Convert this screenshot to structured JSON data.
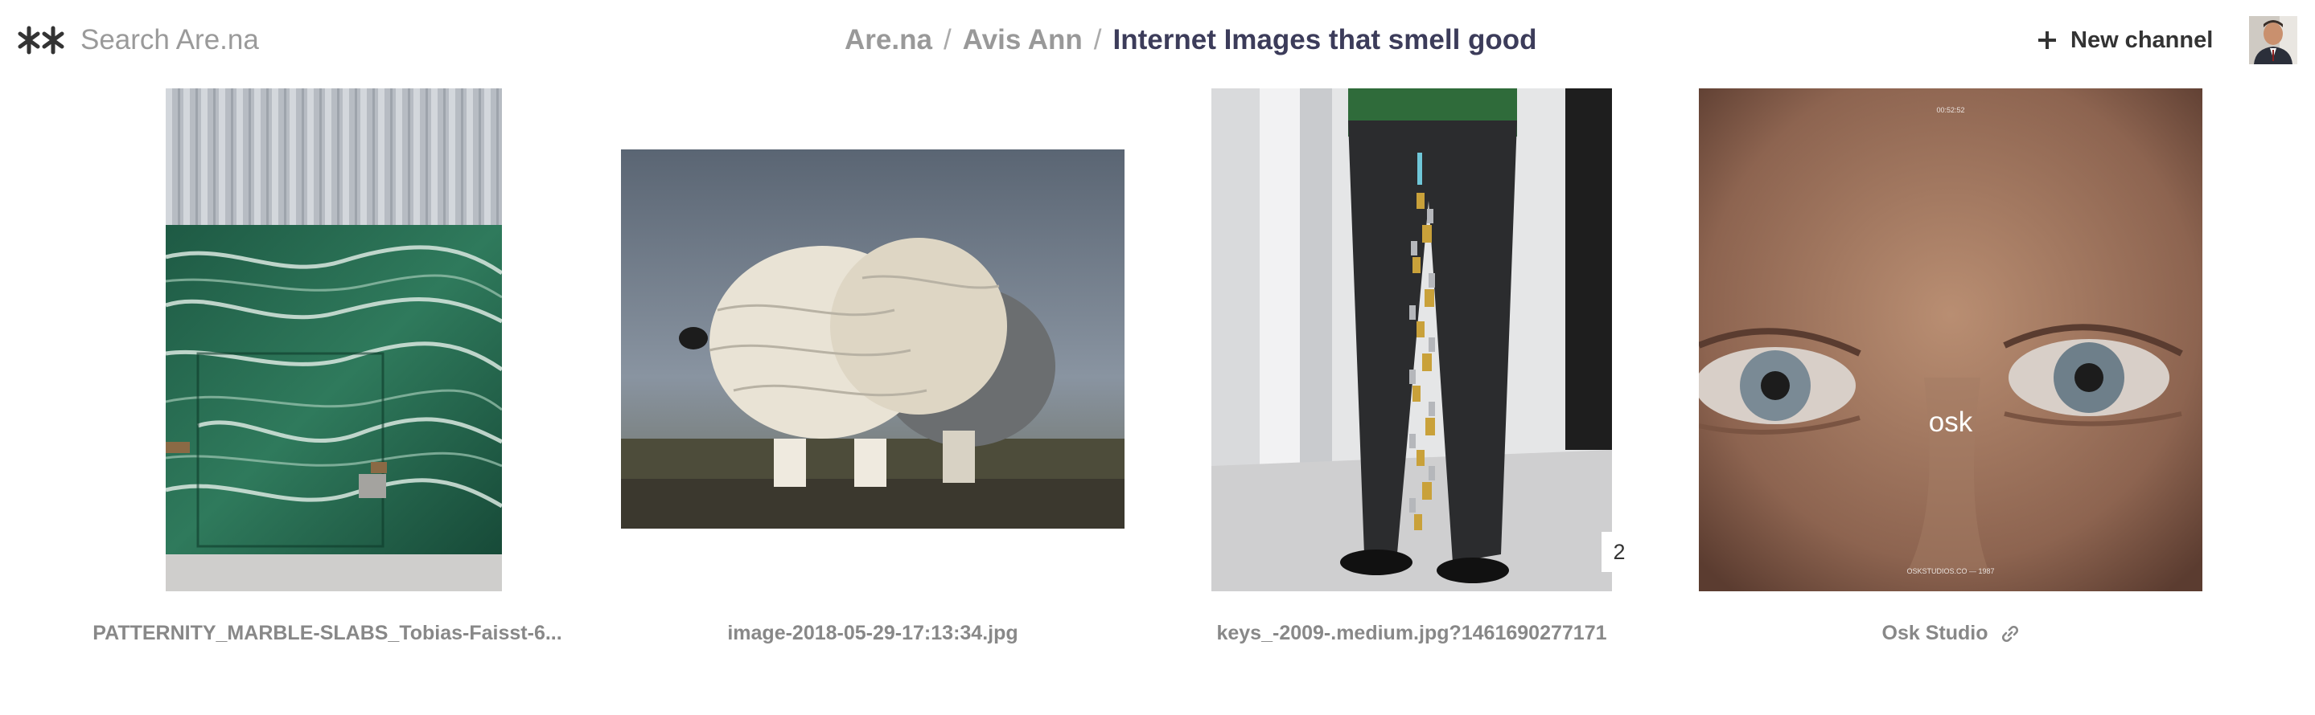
{
  "header": {
    "search_placeholder": "Search Are.na",
    "breadcrumb": [
      "Are.na",
      "Avis Ann"
    ],
    "separator": "/",
    "current": "Internet Images that smell good",
    "new_channel_label": "New channel",
    "icons": {
      "logo": "arena-logo-icon",
      "new": "plus-icon",
      "avatar": "user-avatar"
    }
  },
  "blocks": [
    {
      "title": "PATTERNITY_MARBLE-SLABS_Tobias-Faisst-6...",
      "kind": "image"
    },
    {
      "title": "image-2018-05-29-17:13:34.jpg",
      "kind": "image"
    },
    {
      "title": "keys_-2009-.medium.jpg?1461690277171",
      "kind": "image",
      "connections": "2"
    },
    {
      "title": "Osk Studio",
      "kind": "link",
      "overlay_text": "osk",
      "tiny_top": "00:52:52",
      "tiny_bottom": "OSKSTUDIOS.CO — 1987",
      "icon": "link-icon"
    }
  ]
}
